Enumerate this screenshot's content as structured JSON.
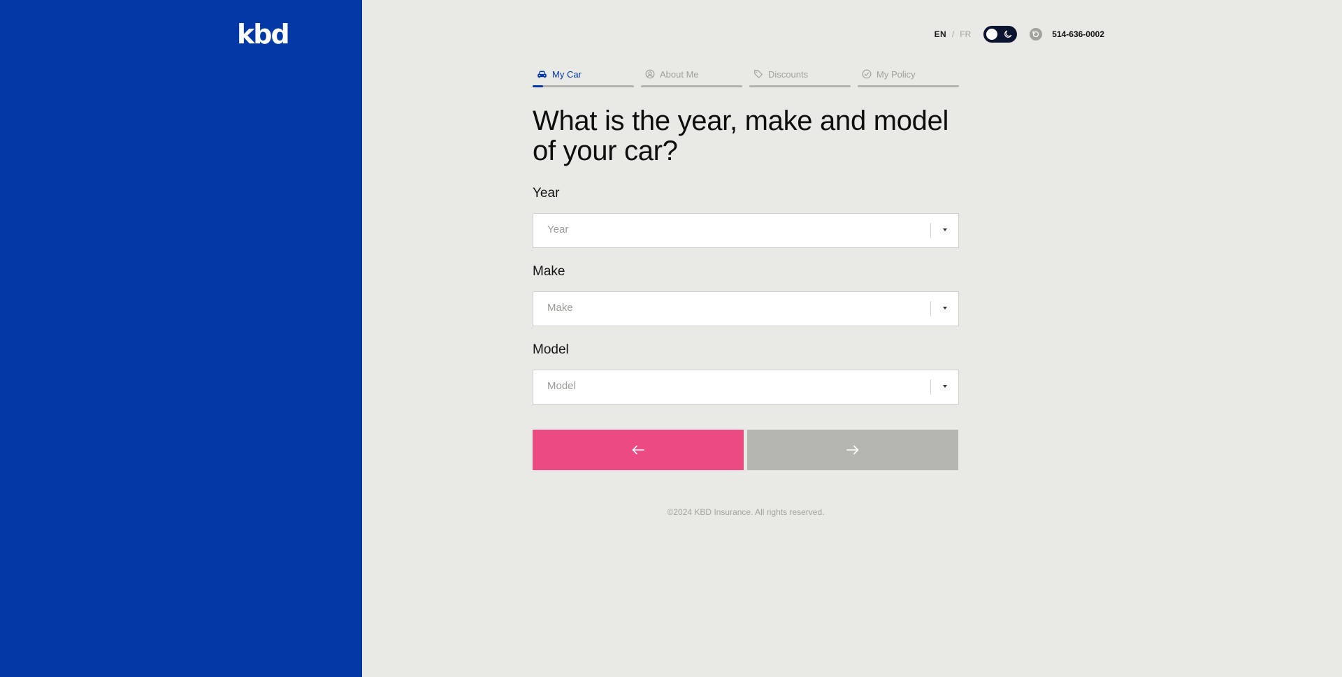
{
  "brand": {
    "logo_text": "kbd",
    "sidebar_color": "#0338a6"
  },
  "topbar": {
    "lang_active": "EN",
    "lang_separator": "/",
    "lang_inactive": "FR",
    "theme_toggle_icon": "moon-icon",
    "reset_icon": "refresh-icon",
    "phone": "514-636-0002"
  },
  "stepper": {
    "steps": [
      {
        "label": "My Car",
        "icon": "car-icon",
        "active": true,
        "progress": 0.1
      },
      {
        "label": "About Me",
        "icon": "user-icon",
        "active": false,
        "progress": 0
      },
      {
        "label": "Discounts",
        "icon": "tag-icon",
        "active": false,
        "progress": 0
      },
      {
        "label": "My Policy",
        "icon": "check-circle-icon",
        "active": false,
        "progress": 0
      }
    ]
  },
  "form": {
    "question": "What is the year, make and model of your car?",
    "fields": [
      {
        "label": "Year",
        "placeholder": "Year"
      },
      {
        "label": "Make",
        "placeholder": "Make"
      },
      {
        "label": "Model",
        "placeholder": "Model"
      }
    ],
    "back_icon": "arrow-left-icon",
    "next_icon": "arrow-right-icon"
  },
  "colors": {
    "accent_pink": "#ec4a83",
    "disabled_gray": "#b6b6b1",
    "primary_blue": "#0338a6"
  },
  "footer": {
    "copyright": "©2024 KBD Insurance. All rights reserved."
  }
}
